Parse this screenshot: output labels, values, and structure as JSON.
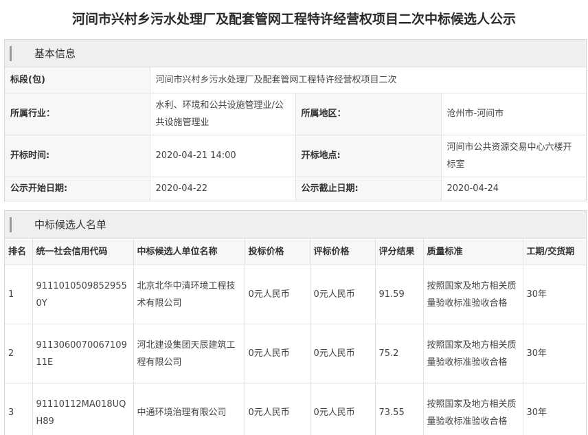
{
  "page_title": "河间市兴村乡污水处理厂及配套管网工程特许经营权项目二次中标候选人公示",
  "basic_info": {
    "heading": "基本信息",
    "bid_section_label": "标段(包)",
    "bid_section_value": "河间市兴村乡污水处理厂及配套管网工程特许经营权项目二次",
    "industry_label": "所属行业：",
    "industry_value": "水利、环境和公共设施管理业/公共设施管理业",
    "region_label": "所属地区：",
    "region_value": "沧州市-河间市",
    "open_time_label": "开标时间:",
    "open_time_value": "2020-04-21 14:00",
    "open_place_label": "开标地点:",
    "open_place_value": "河间市公共资源交易中心六楼开标室",
    "notice_start_label": "公示开始日期:",
    "notice_start_value": "2020-04-22",
    "notice_end_label": "公示截止日期:",
    "notice_end_value": "2020-04-24"
  },
  "candidates": {
    "heading": "中标候选人名单",
    "columns": [
      "排名",
      "统一社会信用代码",
      "中标候选人单位名称",
      "投标价格",
      "评标价格",
      "评分结果",
      "质量标准",
      "工期/交货期"
    ],
    "rows": [
      [
        "1",
        "91110105098529550Y",
        "北京北华中清环境工程技术有限公司",
        "0元人民币",
        "0元人民币",
        "91.59",
        "按照国家及地方相关质量验收标准验收合格",
        "30年"
      ],
      [
        "2",
        "911306007006710911E",
        "河北建设集团天辰建筑工程有限公司",
        "0元人民币",
        "0元人民币",
        "75.2",
        "按照国家及地方相关质量验收标准验收合格",
        "30年"
      ],
      [
        "3",
        "91110112MA018UQH89",
        "中通环境治理有限公司",
        "0元人民币",
        "0元人民币",
        "73.55",
        "按照国家及地方相关质量验收标准验收合格",
        "30年"
      ]
    ]
  }
}
